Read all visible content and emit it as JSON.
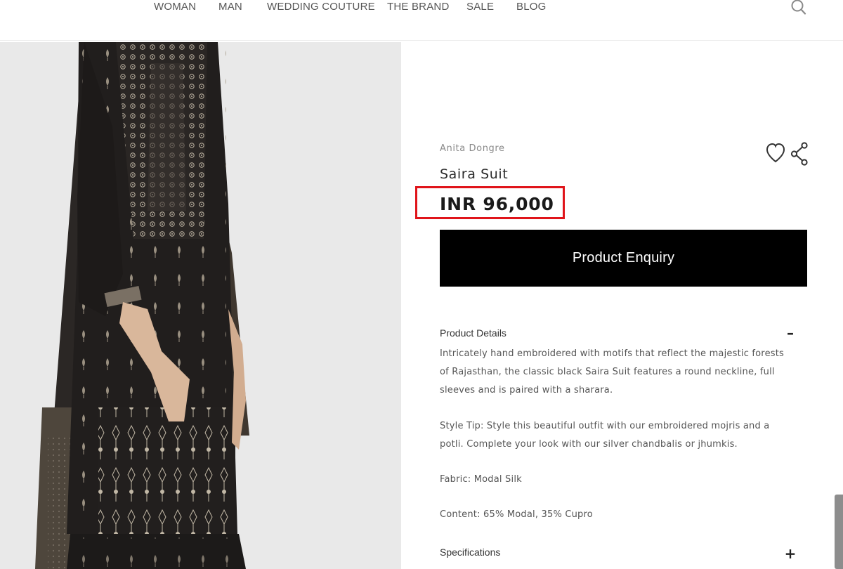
{
  "nav": {
    "items": [
      {
        "label": "WOMAN"
      },
      {
        "label": "MAN"
      },
      {
        "label": "WEDDING COUTURE"
      },
      {
        "label": "THE BRAND"
      },
      {
        "label": "SALE"
      },
      {
        "label": "BLOG"
      }
    ],
    "search_icon": "search-icon"
  },
  "product": {
    "brand": "Anita Dongre",
    "name": "Saira Suit",
    "price": "INR 96,000",
    "highlight_color": "#e0141a",
    "wishlist_icon": "heart-icon",
    "share_icon": "share-icon",
    "enquiry_label": "Product Enquiry"
  },
  "details": {
    "title": "Product Details",
    "toggle": "–",
    "description": "Intricately hand embroidered with motifs that reflect the majestic forests of Rajasthan, the classic black Saira Suit features a round neckline, full sleeves and is paired with a sharara.",
    "style_tip": "Style Tip: Style this beautiful outfit with our embroidered mojris and a potli. Complete your look with our silver chandbalis or jhumkis.",
    "fabric": "Fabric: Modal Silk",
    "content": "Content: 65% Modal, 35% Cupro"
  },
  "specifications": {
    "title": "Specifications",
    "toggle": "+"
  }
}
